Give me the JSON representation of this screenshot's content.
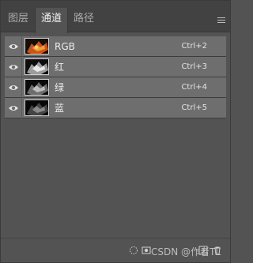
{
  "tabs": [
    {
      "label": "图层",
      "active": false
    },
    {
      "label": "通道",
      "active": true
    },
    {
      "label": "路径",
      "active": false
    }
  ],
  "channels": [
    {
      "name": "RGB",
      "shortcut": "Ctrl+2"
    },
    {
      "name": "红",
      "shortcut": "Ctrl+3"
    },
    {
      "name": "绿",
      "shortcut": "Ctrl+4"
    },
    {
      "name": "蓝",
      "shortcut": "Ctrl+5"
    }
  ],
  "icons": {
    "panel_menu": "hamburger-menu-icon",
    "visibility": "eye-icon",
    "load_selection": "dotted-circle-icon",
    "save_selection": "mask-icon",
    "new_channel": "new-channel-icon",
    "delete_channel": "trash-icon"
  },
  "watermark": "CSDN @作者TL",
  "colors": {
    "panel_bg": "#535353",
    "tabbar_bg": "#424242",
    "row_selected": "#6e6e6e"
  }
}
